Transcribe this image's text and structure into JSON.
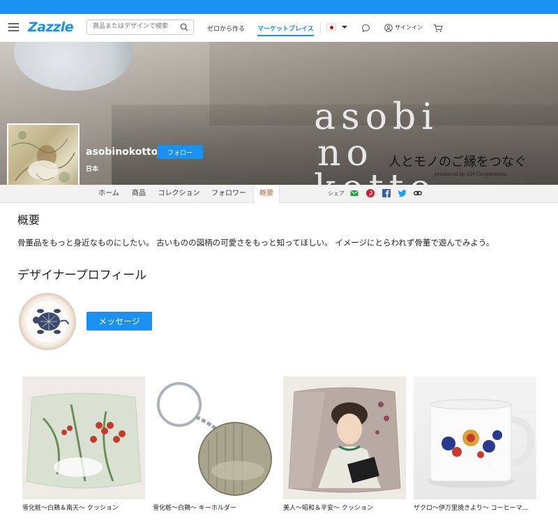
{
  "header": {
    "logo": "Zazzle",
    "search_placeholder": "商品またはデザインで検索",
    "nav": {
      "create": "ゼロから作る",
      "marketplace": "マーケットプレイス",
      "signin": "サインイン"
    }
  },
  "banner": {
    "watermark_line1": "asobi",
    "watermark_line2": "no",
    "watermark_line3": "kotto",
    "tagline": "人とモノのご縁をつなぐ",
    "produced_by": "produced by EN Corporation"
  },
  "profile": {
    "shop_name": "asobinokotto",
    "follow_label": "フォロー",
    "country": "日本"
  },
  "tabs": [
    {
      "label": "ホーム"
    },
    {
      "label": "商品"
    },
    {
      "label": "コレクション"
    },
    {
      "label": "フォロワー"
    },
    {
      "label": "概要"
    }
  ],
  "share": {
    "label": "シェア"
  },
  "about": {
    "title": "概要",
    "description": "骨董品をもっと身近なものにしたい。 古いものの図柄の可愛さをもっと知ってほしい。 イメージにとらわれず骨董で遊んでみよう。"
  },
  "designer": {
    "title": "デザイナープロフィール",
    "message_label": "メッセージ"
  },
  "products": [
    {
      "title": "雪化粧〜白鶏＆南天〜 クッション"
    },
    {
      "title": "雪化粧〜白鶏〜 キーホルダー"
    },
    {
      "title": "美人〜昭和＆平安〜 クッション"
    },
    {
      "title": "ザクロ〜伊万里焼きより〜 コーヒーマ..."
    }
  ],
  "colors": {
    "accent": "#1a91f0",
    "active_tab": "#e2542a"
  }
}
